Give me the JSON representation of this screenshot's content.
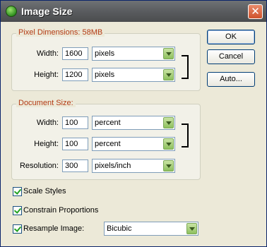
{
  "window": {
    "title": "Image Size"
  },
  "pixel_dimensions": {
    "legend": "Pixel Dimensions:",
    "size": "58MB",
    "width": {
      "label": "Width:",
      "value": "1600",
      "unit": "pixels"
    },
    "height": {
      "label": "Height:",
      "value": "1200",
      "unit": "pixels"
    }
  },
  "document_size": {
    "legend": "Document Size:",
    "width": {
      "label": "Width:",
      "value": "100",
      "unit": "percent"
    },
    "height": {
      "label": "Height:",
      "value": "100",
      "unit": "percent"
    },
    "resolution": {
      "label": "Resolution:",
      "value": "300",
      "unit": "pixels/inch"
    }
  },
  "options": {
    "scale_styles": {
      "label": "Scale Styles",
      "checked": true
    },
    "constrain_proportions": {
      "label": "Constrain Proportions",
      "checked": true
    },
    "resample_image": {
      "label": "Resample Image:",
      "checked": true,
      "method": "Bicubic"
    }
  },
  "buttons": {
    "ok": "OK",
    "cancel": "Cancel",
    "auto": "Auto..."
  },
  "colors": {
    "legend": "#b33a14",
    "titlebar": "#5a5c5f",
    "close": "#d0522c"
  }
}
